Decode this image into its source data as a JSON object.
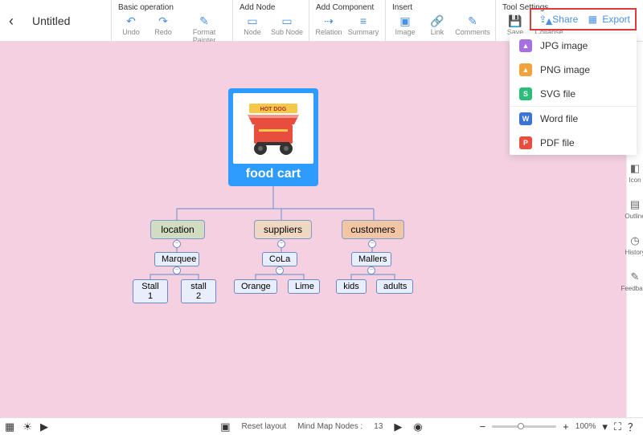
{
  "doc": {
    "title": "Untitled"
  },
  "toolbar": {
    "groups": {
      "basic": {
        "label": "Basic operation",
        "undo": "Undo",
        "redo": "Redo",
        "format_painter": "Format Painter"
      },
      "add_node": {
        "label": "Add Node",
        "node": "Node",
        "sub_node": "Sub Node"
      },
      "add_component": {
        "label": "Add Component",
        "relation": "Relation",
        "summary": "Summary"
      },
      "insert": {
        "label": "Insert",
        "image": "Image",
        "link": "Link",
        "comments": "Comments"
      },
      "tool_settings": {
        "label": "Tool Settings",
        "save": "Save",
        "collapse": "Collapse"
      }
    }
  },
  "share_export": {
    "share": "Share",
    "export": "Export"
  },
  "export_menu": {
    "jpg": "JPG image",
    "png": "PNG image",
    "svg": "SVG file",
    "word": "Word file",
    "pdf": "PDF file"
  },
  "sidepanel": {
    "icon": "Icon",
    "outline": "Outline",
    "history": "History",
    "feedback": "Feedback"
  },
  "statusbar": {
    "reset_layout": "Reset layout",
    "nodes_label": "Mind Map Nodes :",
    "nodes_count": "13",
    "zoom": "100%"
  },
  "mindmap": {
    "root": "food cart",
    "root_image_alt": "HOT DOG",
    "level1": {
      "location": "location",
      "suppliers": "suppliers",
      "customers": "customers"
    },
    "level2": {
      "marquee": "Marquee",
      "cola": "CoLa",
      "mallers": "Mallers"
    },
    "level3": {
      "stall1": "Stall 1",
      "stall2": "stall 2",
      "orange": "Orange",
      "lime": "Lime",
      "kids": "kids",
      "adults": "adults"
    }
  }
}
